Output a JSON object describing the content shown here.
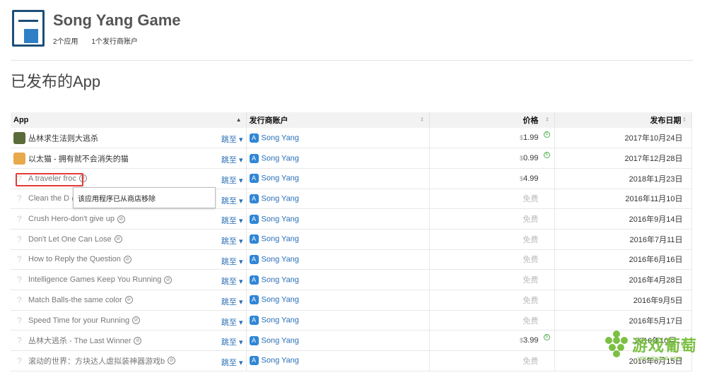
{
  "developer": {
    "name": "Song Yang Game",
    "apps_count": "2个应用",
    "publisher_accounts": "1个发行商账户"
  },
  "section_title": "已发布的App",
  "table": {
    "headers": {
      "app": "App",
      "publisher": "发行商账户",
      "price": "价格",
      "release_date": "发布日期"
    },
    "jump_label": "跳至 ▾",
    "rows": [
      {
        "name": "丛林求生法则大逃杀",
        "publisher": "Song Yang",
        "price": "1.99",
        "currency": "$",
        "date": "2017年10月24日",
        "removed": false,
        "price_changed": true
      },
      {
        "name": "以太猫 - 拥有就不会消失的猫",
        "publisher": "Song Yang",
        "price": "0.99",
        "currency": "$",
        "date": "2017年12月28日",
        "removed": false,
        "price_changed": true
      },
      {
        "name": "A traveler froc",
        "publisher": "Song Yang",
        "price": "4.99",
        "currency": "$",
        "date": "2018年1月23日",
        "removed": true,
        "price_changed": false
      },
      {
        "name": "Clean the D",
        "publisher": "Song Yang",
        "price": "免费",
        "currency": "",
        "date": "2016年11月10日",
        "removed": true,
        "price_changed": false
      },
      {
        "name": "Crush Hero-don't give up",
        "publisher": "Song Yang",
        "price": "免费",
        "currency": "",
        "date": "2016年9月14日",
        "removed": true,
        "price_changed": false
      },
      {
        "name": "Don't Let One Can Lose",
        "publisher": "Song Yang",
        "price": "免费",
        "currency": "",
        "date": "2016年7月11日",
        "removed": true,
        "price_changed": false
      },
      {
        "name": "How to Reply the Question",
        "publisher": "Song Yang",
        "price": "免费",
        "currency": "",
        "date": "2016年6月16日",
        "removed": true,
        "price_changed": false
      },
      {
        "name": "Intelligence Games Keep You Running",
        "publisher": "Song Yang",
        "price": "免费",
        "currency": "",
        "date": "2016年4月28日",
        "removed": true,
        "price_changed": false
      },
      {
        "name": "Match Balls-the same color",
        "publisher": "Song Yang",
        "price": "免费",
        "currency": "",
        "date": "2016年9月5日",
        "removed": true,
        "price_changed": false
      },
      {
        "name": "Speed Time for your Running",
        "publisher": "Song Yang",
        "price": "免费",
        "currency": "",
        "date": "2016年5月17日",
        "removed": true,
        "price_changed": false
      },
      {
        "name": "丛林大逃杀 - The Last Winner",
        "publisher": "Song Yang",
        "price": "3.99",
        "currency": "$",
        "date": "2016年10月...",
        "removed": true,
        "price_changed": true
      },
      {
        "name": "滚动的世界：方块达人虐拟装神器游戏b",
        "publisher": "Song Yang",
        "price": "免费",
        "currency": "",
        "date": "2016年6月15日",
        "removed": true,
        "price_changed": false
      }
    ]
  },
  "tooltip": "该应用程序已从商店移除",
  "watermark": {
    "text": "游戏葡萄",
    "url": "youxiputao.com"
  },
  "colors": {
    "link": "#2a6fb8",
    "highlight": "#e53935",
    "watermark": "#7bc043"
  }
}
